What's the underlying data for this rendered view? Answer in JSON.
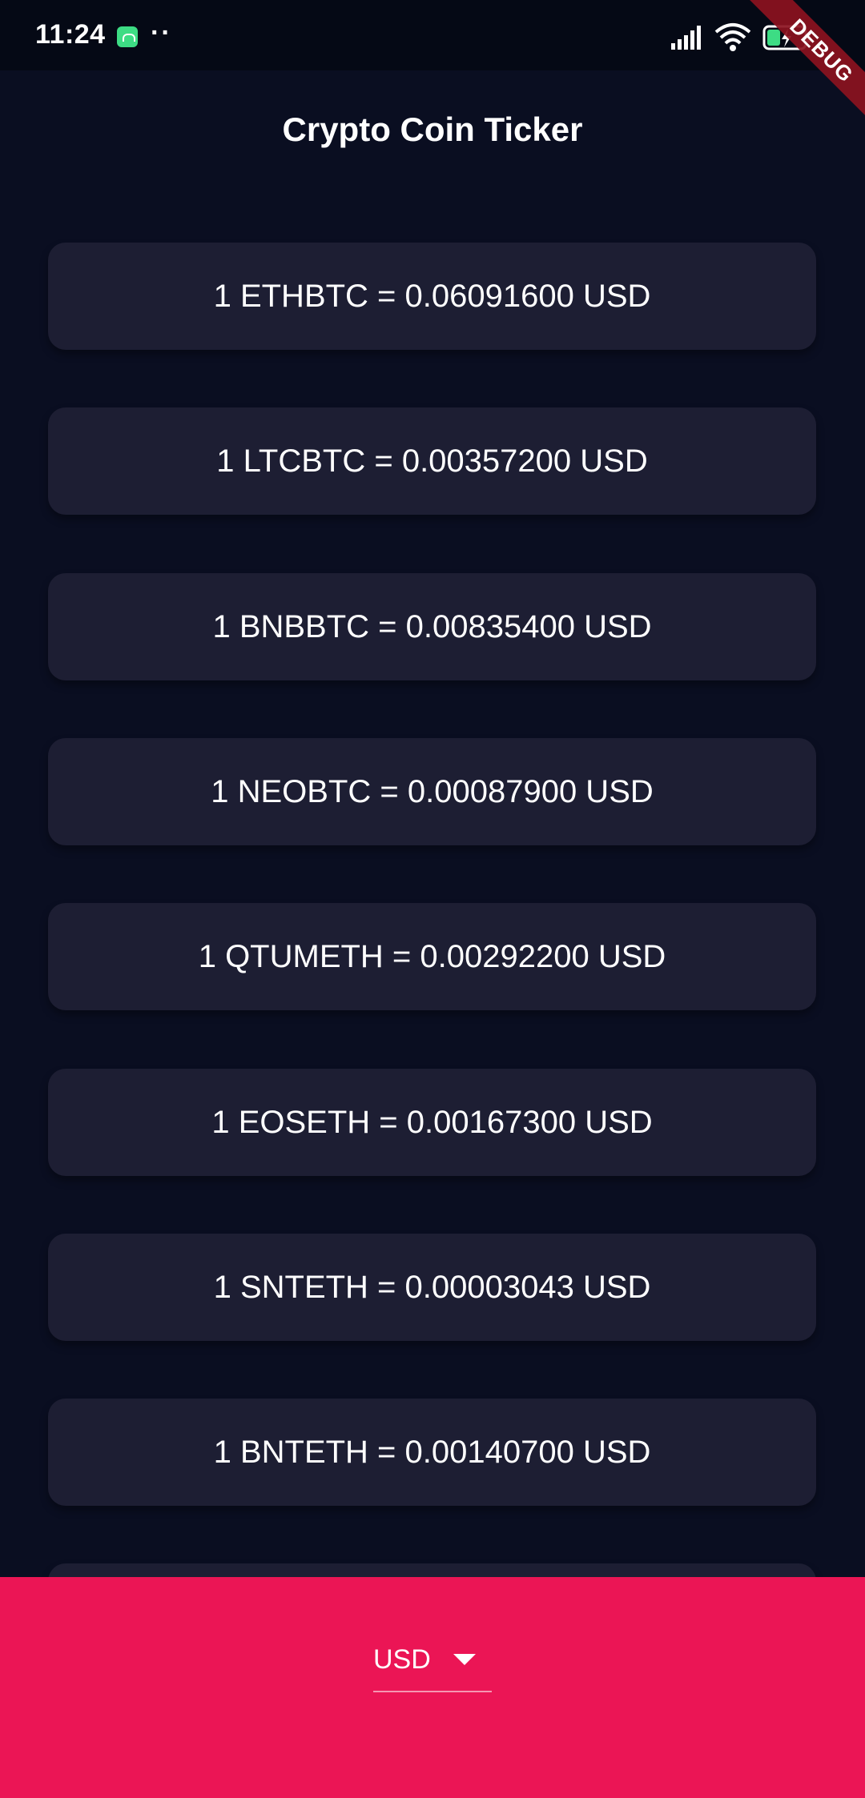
{
  "status_bar": {
    "time": "11:24",
    "dots": "··"
  },
  "debug_banner": {
    "label": "DEBUG"
  },
  "app_bar": {
    "title": "Crypto Coin Ticker"
  },
  "tickers": [
    "1 ETHBTC = 0.06091600 USD",
    "1 LTCBTC = 0.00357200 USD",
    "1 BNBBTC = 0.00835400 USD",
    "1 NEOBTC = 0.00087900 USD",
    "1 QTUMETH = 0.00292200 USD",
    "1 EOSETH = 0.00167300 USD",
    "1 SNTETH = 0.00003043 USD",
    "1 BNTETH = 0.00140700 USD",
    ""
  ],
  "bottom_bar": {
    "currency_selected": "USD"
  },
  "colors": {
    "background": "#0a0e21",
    "card": "#1d1e33",
    "accent": "#eb1555",
    "debug_ribbon": "#8c1220"
  },
  "icons": {
    "status_app": "android-notification-icon",
    "signal": "cellular-signal-icon",
    "wifi": "wifi-icon",
    "battery": "battery-charging-icon",
    "dropdown": "dropdown-arrow-icon"
  }
}
